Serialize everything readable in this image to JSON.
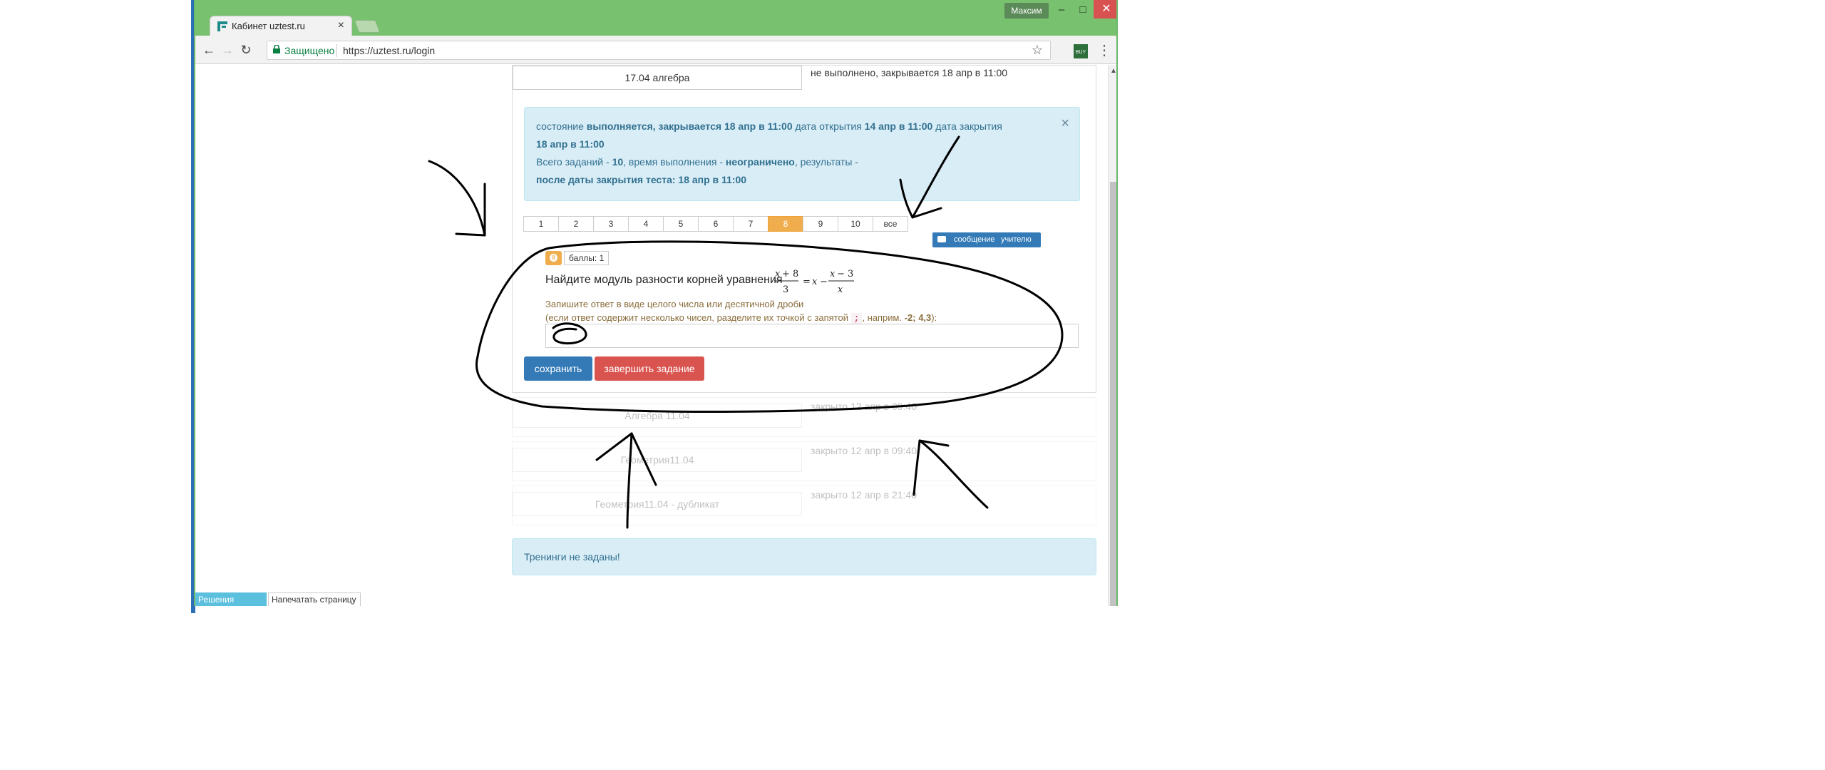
{
  "browser": {
    "user_name": "Максим",
    "tab_title": "Кабинет uztest.ru",
    "secure_label": "Защищено",
    "url": "https://uztest.ru/login",
    "ext_label": "BUY"
  },
  "tests": [
    {
      "name": "17.04 алгебра",
      "state": "не выполнено, закрывается 18 апр в 11:00"
    },
    {
      "name": "Алгебра 11.04",
      "state": "закрыто 12 апр в 09:40"
    },
    {
      "name": "Геометрия11.04",
      "state": "закрыто 12 апр в 09:40"
    },
    {
      "name": "Геометрия11.04 - дубликат",
      "state": "закрыто 12 апр в 21:40"
    }
  ],
  "alert": {
    "l1_pre": "состояние ",
    "l1_b1": "выполняется, закрывается 18 апр в 11:00",
    "l1_mid": " дата открытия ",
    "l1_b2": "14 апр в 11:00",
    "l1_post": " дата закрытия",
    "l2_b": "18 апр в 11:00",
    "l3_pre": "Всего заданий - ",
    "l3_b1": "10",
    "l3_mid": ", время выполнения - ",
    "l3_b2": "неограничено",
    "l3_post": ", результаты -",
    "l4_b": "после даты закрытия теста: 18 апр в 11:00"
  },
  "pager": [
    "1",
    "2",
    "3",
    "4",
    "5",
    "6",
    "7",
    "8",
    "9",
    "10",
    "все"
  ],
  "pager_active": "8",
  "message_button": {
    "t1": "сообщение",
    "t2": "учителю"
  },
  "task": {
    "number": "8",
    "points": "баллы: 1",
    "question": "Найдите модуль разности корней уравнения",
    "hint1": "Запишите ответ в виде целого числа или десятичной дроби",
    "hint2_pre": "(если ответ содержит несколько чисел, разделите их точкой с запятой ",
    "hint2_code": ";",
    "hint2_mid": ", наприм. ",
    "hint2_ex": "-2; 4,3",
    "hint2_post": "):"
  },
  "buttons": {
    "save": "сохранить",
    "finish": "завершить задание"
  },
  "trainings": "Тренинги не заданы!",
  "bottom": {
    "b1": "Решения заданий",
    "b2": "Напечатать страницу"
  },
  "colors": {
    "chrome_green": "#78c26f",
    "primary": "#337ab7",
    "danger": "#d9534f",
    "warning": "#f0ad4e",
    "info_bg": "#d9edf7"
  }
}
